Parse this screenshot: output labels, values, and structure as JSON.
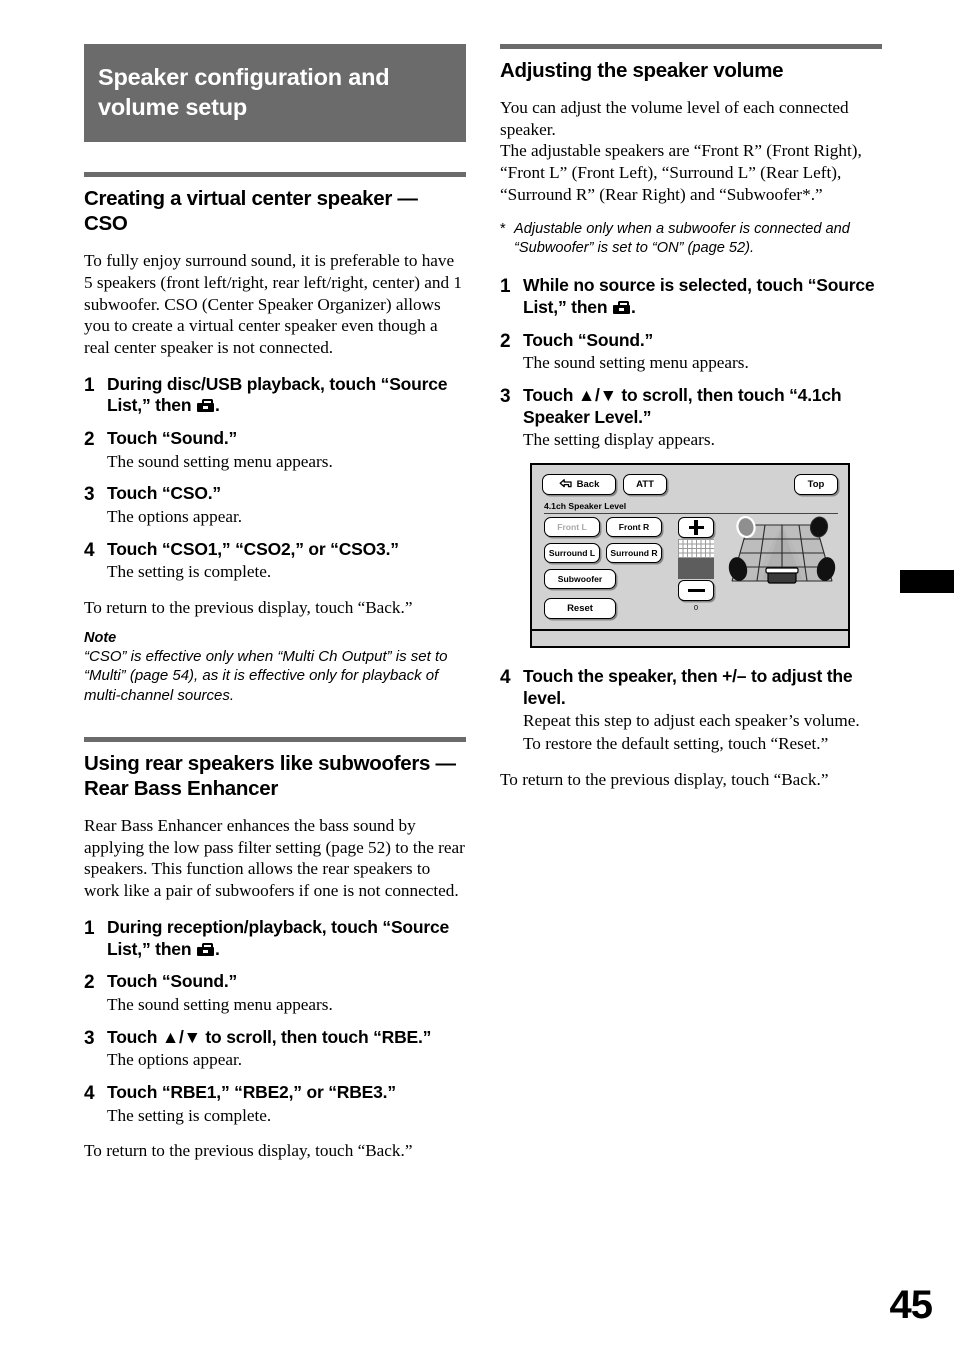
{
  "page": {
    "number": "45"
  },
  "banner": {
    "title": "Speaker configuration and volume setup"
  },
  "left_column": {
    "sections": [
      {
        "heading": "Creating a virtual center speaker — CSO",
        "intro": "To fully enjoy surround sound, it is preferable to have 5 speakers (front left/right, rear left/right, center) and 1 subwoofer. CSO (Center Speaker Organizer) allows you to create a virtual center speaker even though a real center speaker is not connected.",
        "steps": [
          {
            "num": "1",
            "head_before": "During disc/USB playback, touch “Source List,” then",
            "head_after": ".",
            "icon": "toolbox-icon",
            "sub": ""
          },
          {
            "num": "2",
            "head_before": "Touch “Sound.”",
            "head_after": "",
            "icon": "",
            "sub": "The sound setting menu appears."
          },
          {
            "num": "3",
            "head_before": "Touch “CSO.”",
            "head_after": "",
            "icon": "",
            "sub": "The options appear."
          },
          {
            "num": "4",
            "head_before": "Touch “CSO1,” “CSO2,” or “CSO3.”",
            "head_after": "",
            "icon": "",
            "sub": "The setting is complete."
          }
        ],
        "closing": "To return to the previous display, touch “Back.”",
        "note_label": "Note",
        "note_text": "“CSO” is effective only when “Multi Ch Output” is set to “Multi” (page 54), as it is effective only for playback of multi-channel sources."
      },
      {
        "heading": "Using rear speakers like subwoofers — Rear Bass Enhancer",
        "intro": "Rear Bass Enhancer enhances the bass sound by applying the low pass filter setting (page 52) to the rear speakers. This function allows the rear speakers to work like a pair of subwoofers if one is not connected.",
        "steps": [
          {
            "num": "1",
            "head_before": "During reception/playback, touch “Source List,” then",
            "head_after": ".",
            "icon": "toolbox-icon",
            "sub": ""
          },
          {
            "num": "2",
            "head_before": "Touch “Sound.”",
            "head_after": "",
            "icon": "",
            "sub": "The sound setting menu appears."
          },
          {
            "num": "3",
            "head_before": "Touch ▲/▼ to scroll, then touch “RBE.”",
            "head_after": "",
            "icon": "",
            "sub": "The options appear."
          },
          {
            "num": "4",
            "head_before": "Touch “RBE1,” “RBE2,” or “RBE3.”",
            "head_after": "",
            "icon": "",
            "sub": "The setting is complete."
          }
        ],
        "closing": "To return to the previous display, touch “Back.”"
      }
    ]
  },
  "right_column": {
    "heading": "Adjusting the speaker volume",
    "intro_1": "You can adjust the volume level of each connected speaker.",
    "intro_2": "The adjustable speakers are “Front R” (Front Right), “Front L” (Front Left), “Surround L” (Rear Left), “Surround R” (Rear Right) and “Subwoofer*.”",
    "footnote_marker": "*",
    "footnote_text": "Adjustable only when a subwoofer is connected and “Subwoofer” is set to “ON” (page 52).",
    "steps_before": [
      {
        "num": "1",
        "head_before": "While no source is selected, touch “Source List,” then",
        "head_after": ".",
        "icon": "toolbox-icon",
        "sub": ""
      },
      {
        "num": "2",
        "head_before": "Touch “Sound.”",
        "head_after": "",
        "icon": "",
        "sub": "The sound setting menu appears."
      },
      {
        "num": "3",
        "head_before": "Touch ▲/▼ to scroll, then touch “4.1ch Speaker Level.”",
        "head_after": "",
        "icon": "",
        "sub": "The setting display appears."
      }
    ],
    "steps_after": [
      {
        "num": "4",
        "head_before": "Touch the speaker, then +/– to adjust the level.",
        "head_after": "",
        "icon": "",
        "sub_lines": [
          "Repeat this step to adjust each speaker’s volume.",
          "To restore the default setting, touch “Reset.”"
        ]
      }
    ],
    "closing": "To return to the previous display, touch “Back.”"
  },
  "device_screen": {
    "back_label": "Back",
    "att_label": "ATT",
    "top_label": "Top",
    "screen_title": "4.1ch Speaker Level",
    "speaker_buttons": [
      {
        "label": "Front L",
        "state": "dimmed"
      },
      {
        "label": "Front R",
        "state": "normal"
      },
      {
        "label": "Surround L",
        "state": "normal"
      },
      {
        "label": "Surround R",
        "state": "normal"
      },
      {
        "label": "Subwoofer",
        "state": "normal"
      }
    ],
    "plus_icon": "plus-icon",
    "minus_icon": "minus-icon",
    "level_value": "0",
    "reset_label": "Reset"
  },
  "colors": {
    "banner_bg": "#6b6b6b",
    "rule": "#6b6b6b",
    "screen_bg": "#d2d2d2",
    "level_fill": "#5d5d5d",
    "text": "#000000"
  }
}
